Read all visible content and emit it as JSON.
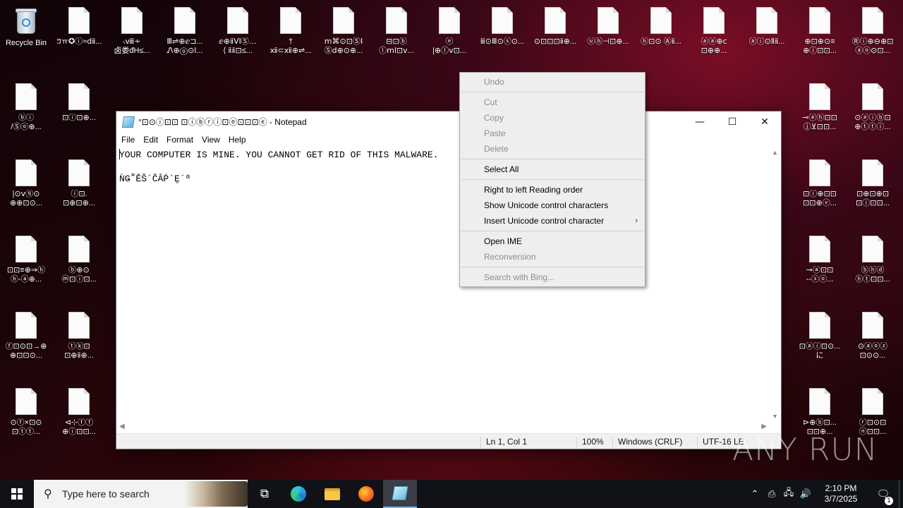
{
  "desktop": {
    "recycle_bin_label": "Recycle Bin",
    "row1_labels": [
      "ៗㅠ✪ⓘ≈ⅾⅱ...",
      "៶ⅷ∻\n卤娄ᵭH≤...",
      "Ⅲ⇌⊕ⅇ⊐...\nᏁ⊕ⓞ⊙ⅼ...",
      "ⅇ⊕ⅱⅤⅠⓈ…\n⟨ ⅱⅱ⊡≤...",
      "†\nⅻ⊂ⅻ⊕⇌...",
      "ⅿ⌘⊙⊡ⓈⅠ\nⓈⅾ⊕⊙⊕...",
      "⊟⊡ⓑ\nⓛⅿⅼ⊡ⅴ...",
      "ⓔ\n|⊕ⓛⅴ⊡...",
      "ⅲ⊙Ⅲ⊙ⓢ⊙...",
      "⊙⊡⊡⊡ⅱ⊕...",
      "ⓤⓗ⊣⊡⊕...",
      "ⓗ⊡⊙ Ⓐⅱ...",
      "ⓐⓐ⊕ⅽ\n⊡⊕⊕...",
      "ⓐⓘ⊙Ⅱⅱ...",
      "⊕⊡⊕⊙≡\n⊕ⓘ⊡⊡...",
      "Ⓡⓘ⊕⊖⊕⊡\nⓐⓞ⊙⊡..."
    ],
    "left_col_labels": [
      "ⓑⓘ\n/Ⓢⓞ⊕...",
      "⊡ⓘ⊡⊕...",
      "|⊙ⅴⓠ⊙\n⊕⊕⊡⊙...",
      "ⓘ⊡.\n⊡⊕⊡⊕...",
      "⊡⊡≡⊕⇒ⓗ\nⓗ-ⓐ⊕...",
      "ⓑ⊕⊙\nⓜ⊡ⓘ⊡...",
      "ⓕ⊡⊙⊡→⊕\n⊕⊡⊡⊙...",
      "ⓣⓚ⊡\n⊡⊕ⅱ⊕...",
      "⊙ⓕ×⊡⊙\n⊡ⓣⓣ...",
      "⊲⊹ⓕⓕ\n⊕ⓘ⊡⊡..."
    ],
    "right_col_labels": [
      "⊸ⓐⓗ⊡⊡\nⓙ⊻⊡⊡...",
      "⊙ⓐⓘⓑ⊡\n⊕ⓣⓣⓘ...",
      "⊡ⓘ⊕⊡⊡\n⊡⊡⊕ⓥ...",
      "⊡⊕⊡⊕⊡\n⊡ⓘ⊡⊡...",
      "⊸ⓐ⊡⊡\n--ⓢⓞ...",
      "ⓑⓗⓓ\nⓗⓣ⊡⊡...",
      "⊡ⓐⓘ⊡⊙...\nに",
      "⊙ⓐⓞⓩ\n⊡⊙⊙...",
      "⊳⊕ⓑ⊡...\n⊡⊡⊕...",
      "ⓡ⊡⊙⊡\nⓝ⊡⊡..."
    ]
  },
  "notepad": {
    "title": "°⊡⊙ⓘ⊡⊡ ⊡ⓘⓑⓡⓘ⊡ⓞ⊡⊡⊡ⓔ - Notepad",
    "menu": [
      "File",
      "Edit",
      "Format",
      "View",
      "Help"
    ],
    "content_line1": "YOUR COMPUTER IS MINE. YOU CANNOT GET RID OF THIS MALWARE.",
    "content_line2": "ǸǤ˜̃ĔŠ´ČÂṔ`Ḙ´ª",
    "status": {
      "position": "Ln 1, Col 1",
      "zoom": "100%",
      "line_ending": "Windows (CRLF)",
      "encoding": "UTF-16 LE"
    }
  },
  "context_menu": {
    "groups": [
      [
        {
          "label": "Undo",
          "enabled": false
        }
      ],
      [
        {
          "label": "Cut",
          "enabled": false
        },
        {
          "label": "Copy",
          "enabled": false
        },
        {
          "label": "Paste",
          "enabled": false
        },
        {
          "label": "Delete",
          "enabled": false
        }
      ],
      [
        {
          "label": "Select All",
          "enabled": true
        }
      ],
      [
        {
          "label": "Right to left Reading order",
          "enabled": true
        },
        {
          "label": "Show Unicode control characters",
          "enabled": true
        },
        {
          "label": "Insert Unicode control character",
          "enabled": true,
          "submenu": true
        }
      ],
      [
        {
          "label": "Open IME",
          "enabled": true
        },
        {
          "label": "Reconversion",
          "enabled": false
        }
      ],
      [
        {
          "label": "Search with Bing...",
          "enabled": false
        }
      ]
    ]
  },
  "taskbar": {
    "search_placeholder": "Type here to search",
    "time": "2:10 PM",
    "date": "3/7/2025",
    "notification_count": "1"
  },
  "watermark": "ANY RUN"
}
